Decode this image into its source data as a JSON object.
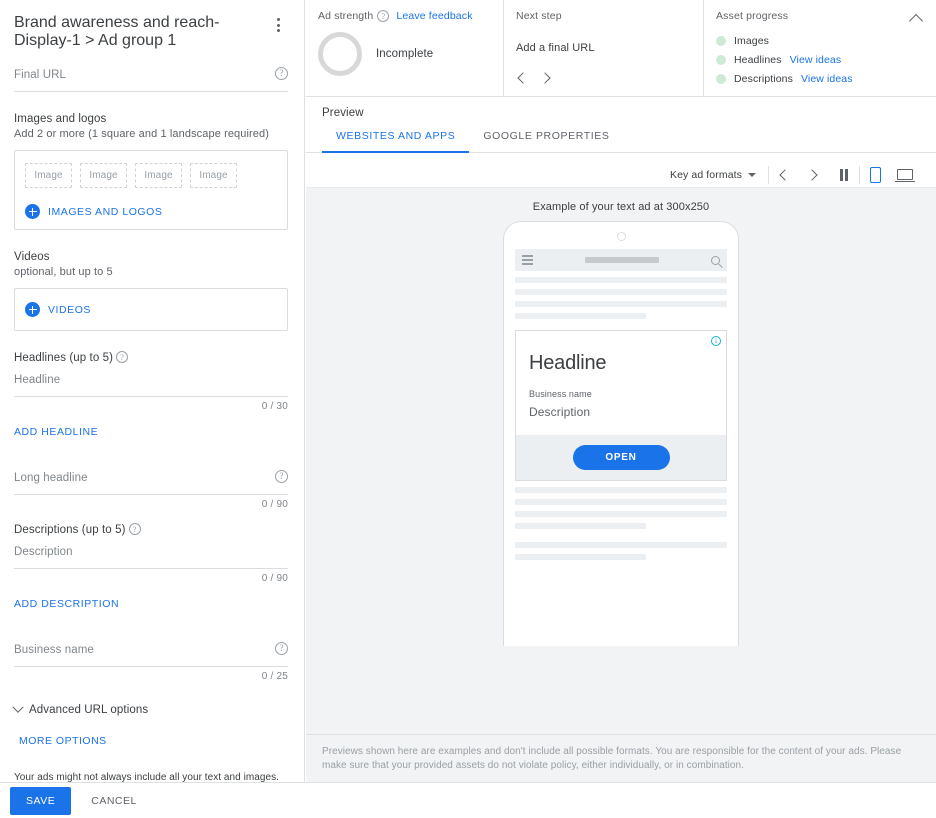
{
  "form": {
    "breadcrumb": "Brand awareness and reach-Display-1 > Ad group 1",
    "final_url": {
      "label": "Final URL",
      "value": ""
    },
    "images_and_logos": {
      "title": "Images and logos",
      "subtitle": "Add 2 or more (1 square and 1 landscape required)",
      "placeholders": [
        "Image",
        "Image",
        "Image",
        "Image"
      ],
      "add_label": "IMAGES AND LOGOS"
    },
    "videos": {
      "title": "Videos",
      "subtitle": "optional, but up to 5",
      "add_label": "VIDEOS"
    },
    "headlines": {
      "title": "Headlines (up to 5)",
      "field_label": "Headline",
      "counter": "0 / 30",
      "add_label": "ADD HEADLINE"
    },
    "long_headline": {
      "field_label": "Long headline",
      "counter": "0 / 90"
    },
    "descriptions": {
      "title": "Descriptions (up to 5)",
      "field_label": "Description",
      "counter": "0 / 90",
      "add_label": "ADD DESCRIPTION"
    },
    "business_name": {
      "field_label": "Business name",
      "counter": "0 / 25"
    },
    "advanced_url_options": "Advanced URL options",
    "more_options": "MORE OPTIONS",
    "disclaimer": "Your ads might not always include all your text and images. Some cropping or shortening may occur in some formats, and either of your custom colors may be used."
  },
  "status": {
    "ad_strength": {
      "title": "Ad strength",
      "feedback_link": "Leave feedback",
      "value": "Incomplete",
      "ring_color": "#d8d8d8"
    },
    "next_step": {
      "title": "Next step",
      "text": "Add a final URL"
    },
    "asset_progress": {
      "title": "Asset progress",
      "dot_color": "#ceead6",
      "items": [
        {
          "name": "Images",
          "link": ""
        },
        {
          "name": "Headlines",
          "link": "View ideas"
        },
        {
          "name": "Descriptions",
          "link": "View ideas"
        }
      ]
    }
  },
  "preview": {
    "title": "Preview",
    "tabs": [
      {
        "label": "WEBSITES AND APPS",
        "active": true
      },
      {
        "label": "GOOGLE PROPERTIES",
        "active": false
      }
    ],
    "toolbar": {
      "format_selector": "Key ad formats",
      "device_active": "mobile"
    },
    "example_caption": "Example of your text ad at 300x250",
    "ad": {
      "headline": "Headline",
      "business_name": "Business name",
      "description": "Description",
      "cta": "OPEN"
    },
    "footer_disclaimer": "Previews shown here are examples and don't include all possible formats. You are responsible for the content of your ads. Please make sure that your provided assets do not violate policy, either individually, or in combination."
  },
  "actions": {
    "save": "SAVE",
    "cancel": "CANCEL"
  },
  "colors": {
    "accent": "#1a73e8",
    "text": "#3c4043",
    "muted": "#80868b"
  }
}
